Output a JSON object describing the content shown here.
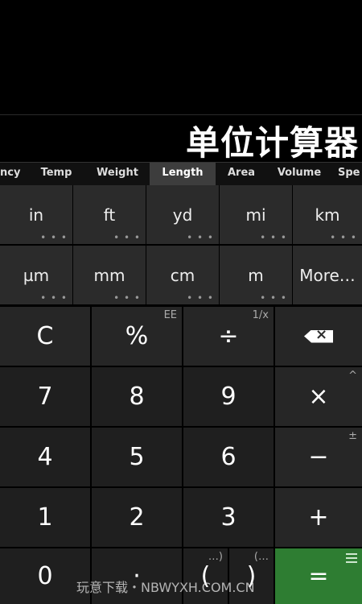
{
  "title": "单位计算器",
  "tabs": [
    {
      "label": "ncy"
    },
    {
      "label": "Temp"
    },
    {
      "label": "Weight"
    },
    {
      "label": "Length",
      "active": true
    },
    {
      "label": "Area"
    },
    {
      "label": "Volume"
    },
    {
      "label": "Spe"
    }
  ],
  "units_row1": [
    {
      "label": "in",
      "dots": "• • •"
    },
    {
      "label": "ft",
      "dots": "• • •"
    },
    {
      "label": "yd",
      "dots": "• • •"
    },
    {
      "label": "mi",
      "dots": "• • •"
    },
    {
      "label": "km",
      "dots": "• • •"
    }
  ],
  "units_row2": [
    {
      "label": "µm",
      "dots": "• • •"
    },
    {
      "label": "mm",
      "dots": "• • •"
    },
    {
      "label": "cm",
      "dots": "• • •"
    },
    {
      "label": "m",
      "dots": "• • •"
    },
    {
      "label": "More…"
    }
  ],
  "keys": {
    "clear": "C",
    "percent": "%",
    "percent_alt": "EE",
    "divide": "÷",
    "divide_alt": "1/x",
    "multiply": "×",
    "multiply_alt": "^",
    "minus": "−",
    "minus_alt": "±",
    "plus": "+",
    "equals": "=",
    "seven": "7",
    "eight": "8",
    "nine": "9",
    "four": "4",
    "five": "5",
    "six": "6",
    "one": "1",
    "two": "2",
    "three": "3",
    "zero": "0",
    "decimal": "·",
    "open_paren": "(",
    "open_paren_alt": "…)",
    "close_paren": ")",
    "close_paren_alt": "(…"
  },
  "icons": {
    "backspace": "backspace-icon",
    "menu": "menu-lines-icon"
  },
  "colors": {
    "equals_key": "#2e7d32",
    "active_tab": "#3d3d3d"
  },
  "watermark": "玩意下载・NBWYXH.COM.CN"
}
